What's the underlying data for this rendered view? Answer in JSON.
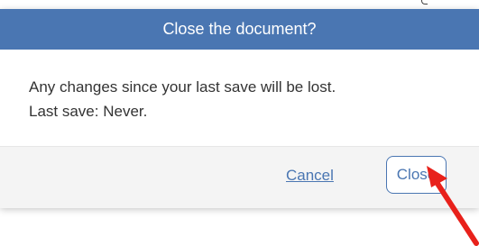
{
  "dialog": {
    "title": "Close the document?",
    "message_line1": "Any changes since your last save will be lost.",
    "message_line2": "Last save: Never.",
    "cancel_label": "Cancel",
    "close_label": "Close"
  },
  "colors": {
    "header_bg": "#4a76b2",
    "accent": "#4a76b2",
    "footer_bg": "#f4f4f4",
    "annotation_arrow": "#e8211b"
  },
  "annotation": {
    "icon": "red-arrow-icon"
  }
}
